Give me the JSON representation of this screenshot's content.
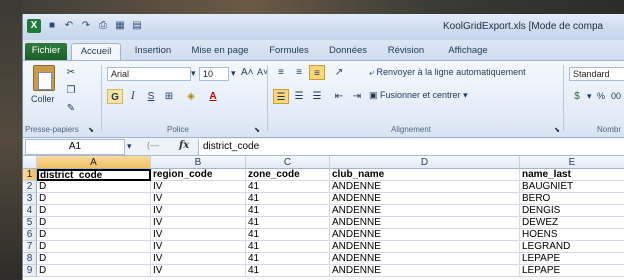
{
  "window": {
    "title": "KoolGridExport.xls  [Mode de compa"
  },
  "qat_icons": [
    "save-icon",
    "undo-icon",
    "redo-icon",
    "print-icon",
    "table-icon",
    "chart-icon"
  ],
  "tabs": [
    "Fichier",
    "Accueil",
    "Insertion",
    "Mise en page",
    "Formules",
    "Données",
    "Révision",
    "Affichage"
  ],
  "active_tab": "Accueil",
  "ribbon": {
    "clipboard": {
      "paste_label": "Coller",
      "group_label": "Presse-papiers"
    },
    "font": {
      "family": "Arial",
      "size": "10",
      "bold": "G",
      "italic": "I",
      "underline": "S",
      "group_label": "Police"
    },
    "alignment": {
      "wrap_label": "Renvoyer à la ligne automatiquement",
      "merge_label": "Fusionner et centrer",
      "group_label": "Alignement"
    },
    "number": {
      "format": "Standard",
      "percent": "%",
      "zeros": "00",
      "group_label": "Nombr"
    }
  },
  "formula_bar": {
    "cell_ref": "A1",
    "fx": "fx",
    "value": "district_code"
  },
  "grid": {
    "columns": [
      "A",
      "B",
      "C",
      "D",
      "E"
    ],
    "row_numbers": [
      "1",
      "2",
      "3",
      "4",
      "5",
      "6",
      "7",
      "8",
      "9"
    ],
    "rows": [
      [
        "district_code",
        "region_code",
        "zone_code",
        "club_name",
        "name_last"
      ],
      [
        "D",
        "IV",
        "41",
        "ANDENNE",
        "BAUGNIET"
      ],
      [
        "D",
        "IV",
        "41",
        "ANDENNE",
        "BERO"
      ],
      [
        "D",
        "IV",
        "41",
        "ANDENNE",
        "DENGIS"
      ],
      [
        "D",
        "IV",
        "41",
        "ANDENNE",
        "DEWEZ"
      ],
      [
        "D",
        "IV",
        "41",
        "ANDENNE",
        "HOENS"
      ],
      [
        "D",
        "IV",
        "41",
        "ANDENNE",
        "LEGRAND"
      ],
      [
        "D",
        "IV",
        "41",
        "ANDENNE",
        "LEPAPE"
      ],
      [
        "D",
        "IV",
        "41",
        "ANDENNE",
        "LEPAPE"
      ]
    ]
  }
}
